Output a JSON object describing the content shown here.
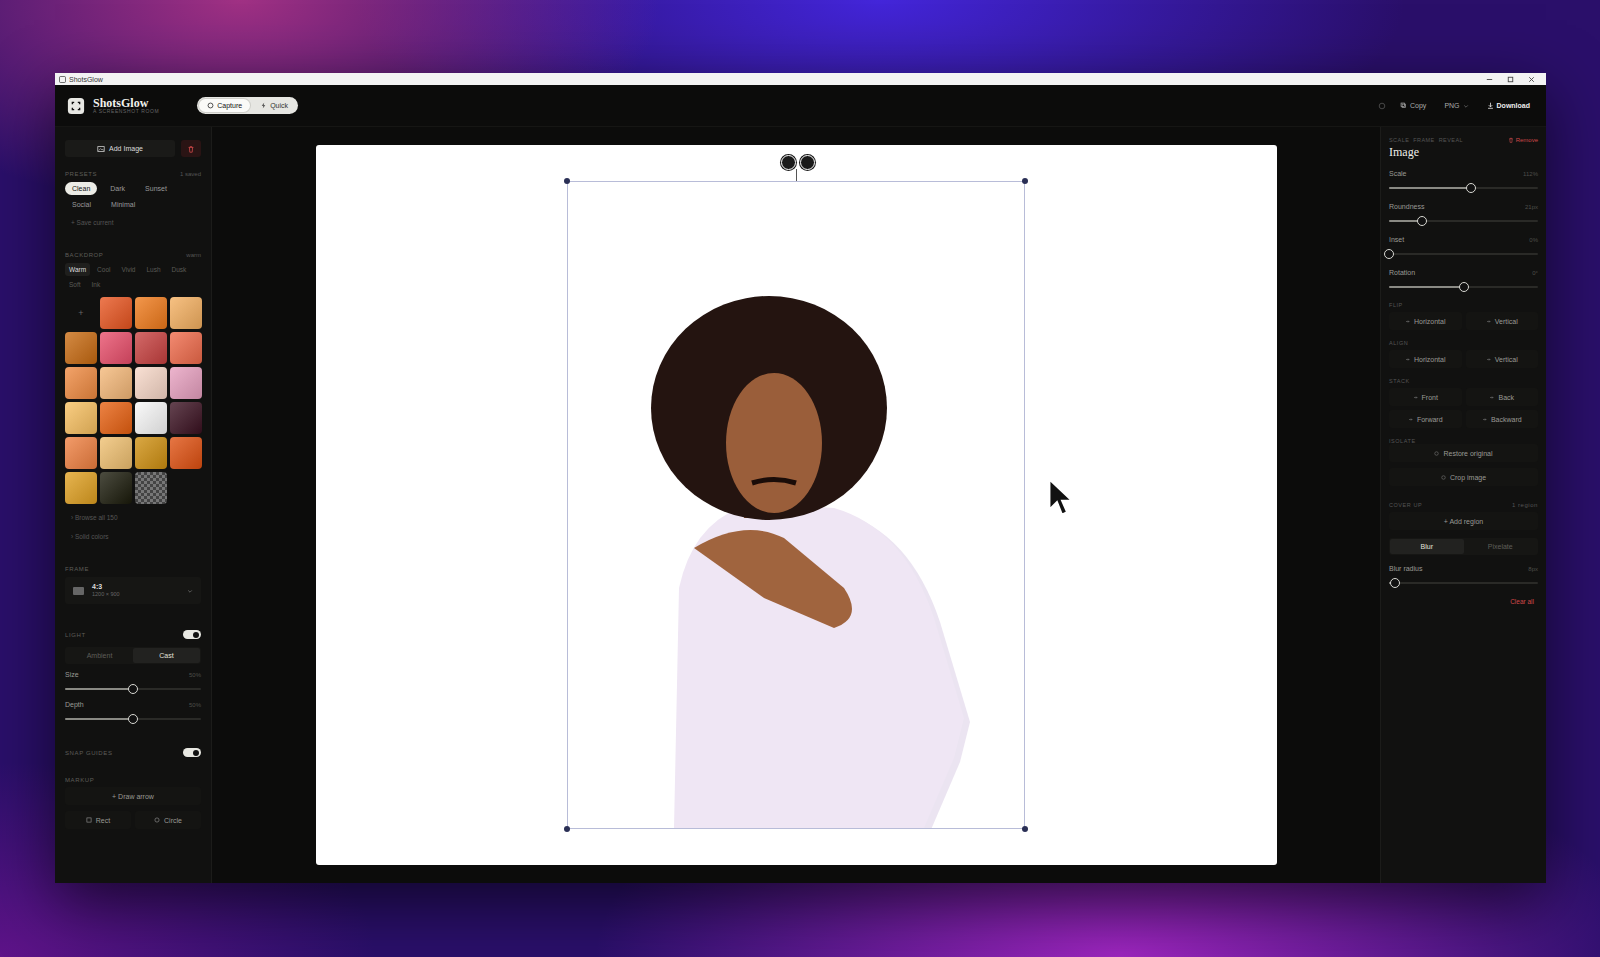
{
  "window": {
    "title": "ShotsGlow"
  },
  "header": {
    "app_name": "ShotsGlow",
    "tagline": "A SCREENSHOT ROOM",
    "modes": [
      {
        "label": "Capture",
        "selected": true
      },
      {
        "label": "Quick",
        "selected": false
      }
    ],
    "copy": "Copy",
    "format": "PNG",
    "download": "Download"
  },
  "sidebar": {
    "add_image": "Add Image",
    "presets": {
      "title": "PRESETS",
      "count": "1 saved",
      "items": [
        {
          "label": "Clean",
          "selected": true
        },
        {
          "label": "Dark",
          "selected": false
        },
        {
          "label": "Sunset",
          "selected": false
        },
        {
          "label": "Social",
          "selected": false
        },
        {
          "label": "Minimal",
          "selected": false
        }
      ],
      "save": "+ Save current"
    },
    "backdrop": {
      "title": "BACKDROP",
      "current": "warm",
      "tabs": [
        {
          "label": "Warm",
          "selected": true
        },
        {
          "label": "Cool",
          "selected": false
        },
        {
          "label": "Vivid",
          "selected": false
        },
        {
          "label": "Lush",
          "selected": false
        },
        {
          "label": "Dusk",
          "selected": false
        },
        {
          "label": "Soft",
          "selected": false
        },
        {
          "label": "Ink",
          "selected": false
        }
      ],
      "swatches": [
        {
          "kind": "add",
          "label": "+"
        },
        {
          "kind": "color",
          "color": "#e8541f"
        },
        {
          "kind": "color",
          "color": "#f07a1a"
        },
        {
          "kind": "color",
          "color": "#f5b060"
        },
        {
          "kind": "color",
          "color": "#c86a10"
        },
        {
          "kind": "color",
          "color": "#e94d6a"
        },
        {
          "kind": "color",
          "color": "#c8403f"
        },
        {
          "kind": "color",
          "color": "#f06a4a"
        },
        {
          "kind": "color",
          "color": "#f08a40"
        },
        {
          "kind": "color",
          "color": "#f5b878"
        },
        {
          "kind": "color",
          "color": "#f8d8c8"
        },
        {
          "kind": "color",
          "color": "#e8a0c0"
        },
        {
          "kind": "color",
          "color": "#f8c060"
        },
        {
          "kind": "color",
          "color": "#e86010"
        },
        {
          "kind": "color",
          "color": "#f8f8f8"
        },
        {
          "kind": "color",
          "color": "#3a1020"
        },
        {
          "kind": "color",
          "color": "#f08040"
        },
        {
          "kind": "color",
          "color": "#f0c070"
        },
        {
          "kind": "color",
          "color": "#d09010"
        },
        {
          "kind": "color",
          "color": "#e05010"
        },
        {
          "kind": "color",
          "color": "#e0a020"
        },
        {
          "kind": "color",
          "color": "#1a1a0a"
        },
        {
          "kind": "transparent"
        }
      ],
      "browse": "› Browse all 150",
      "solid": "› Solid colors"
    },
    "frame": {
      "title": "FRAME",
      "ratio": "4:3",
      "size": "1200 × 900"
    },
    "light": {
      "title": "LIGHT",
      "on": true,
      "modes": [
        {
          "label": "Ambient",
          "selected": false
        },
        {
          "label": "Cast",
          "selected": true
        }
      ],
      "sliders": [
        {
          "label": "Size",
          "reading": "50%",
          "level": 0.5
        },
        {
          "label": "Depth",
          "reading": "50%",
          "level": 0.5
        }
      ]
    },
    "snap_guides": {
      "title": "SNAP GUIDES",
      "on": true
    },
    "markup": {
      "title": "MARKUP",
      "draw_arrow": "+ Draw arrow",
      "shapes": [
        "Rect",
        "Circle"
      ]
    }
  },
  "inspector": {
    "tabs": [
      "SCALE",
      "FRAME",
      "REVEAL"
    ],
    "remove": "Remove",
    "title": "Image",
    "sliders": [
      {
        "label": "Scale",
        "reading": "112%",
        "level": 0.55
      },
      {
        "label": "Roundness",
        "reading": "21px",
        "level": 0.22
      },
      {
        "label": "Inset",
        "reading": "0%",
        "level": 0
      },
      {
        "label": "Rotation",
        "reading": "0°",
        "level": 0.5
      }
    ],
    "flip": {
      "title": "FLIP",
      "buttons": [
        "Horizontal",
        "Vertical"
      ]
    },
    "align": {
      "title": "ALIGN",
      "buttons": [
        "Horizontal",
        "Vertical"
      ]
    },
    "stack": {
      "title": "STACK",
      "buttons": [
        "Front",
        "Back",
        "Forward",
        "Backward"
      ]
    },
    "isolate": {
      "title": "ISOLATE",
      "buttons": [
        "Restore original",
        "Crop image"
      ]
    },
    "cover_up": {
      "title": "COVER UP",
      "count": "1 region",
      "add": "+ Add region",
      "modes": [
        {
          "label": "Blur",
          "selected": true
        },
        {
          "label": "Pixelate",
          "selected": false
        }
      ],
      "slider": {
        "label": "Blur radius",
        "reading": "8px",
        "level": 0.04
      },
      "clear": "Clear all"
    }
  }
}
